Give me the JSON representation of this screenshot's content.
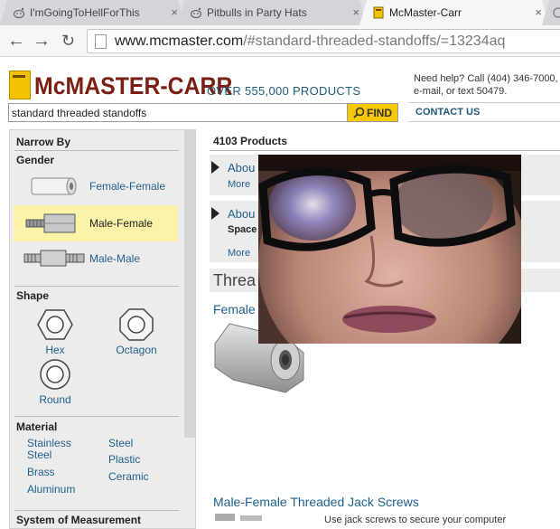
{
  "browser": {
    "tabs": [
      {
        "title": "I'mGoingToHellForThis",
        "close": "×",
        "icon": "reddit-icon"
      },
      {
        "title": "Pitbulls in Party Hats",
        "close": "×",
        "icon": "reddit-icon"
      },
      {
        "title": "McMaster-Carr",
        "close": "×",
        "icon": "mcmaster-icon"
      }
    ],
    "url_host": "www.mcmaster.com",
    "url_path": "/#standard-threaded-standoffs/=13234aq"
  },
  "site": {
    "logo": "McMASTER-CARR",
    "tagline": "OVER 555,000 PRODUCTS",
    "help_line1": "Need help? Call (404) 346-7000,",
    "help_line2": "e-mail, or text 50479.",
    "search_value": "standard threaded standoffs",
    "find_label": "FIND",
    "contact": "CONTACT US"
  },
  "narrow": {
    "title": "Narrow By",
    "gender_title": "Gender",
    "gender": [
      {
        "label": "Female-Female",
        "selected": false
      },
      {
        "label": "Male-Female",
        "selected": true
      },
      {
        "label": "Male-Male",
        "selected": false
      }
    ],
    "shape_title": "Shape",
    "shapes": [
      "Hex",
      "Octagon",
      "Round"
    ],
    "material_title": "Material",
    "materials_left": [
      "Stainless",
      "Steel",
      "Brass",
      "Aluminum"
    ],
    "materials_right": [
      "Steel",
      "Plastic",
      "Ceramic"
    ],
    "system_title": "System of Measurement"
  },
  "main": {
    "count": "4103 Products",
    "about1_title": "Abou",
    "about1_more": "More",
    "about2_title": "Abou",
    "about2_sub": "Space",
    "about2_more": "More",
    "section_title": "Threa",
    "female_link": "Female",
    "jack_link": "Male-Female Threaded Jack Screws",
    "jack_desc": "Use jack screws to secure your computer"
  },
  "colors": {
    "link": "#1d5f8c",
    "logo": "#7a1f12",
    "find": "#f6c800",
    "selected_row": "#fbf4a8"
  }
}
